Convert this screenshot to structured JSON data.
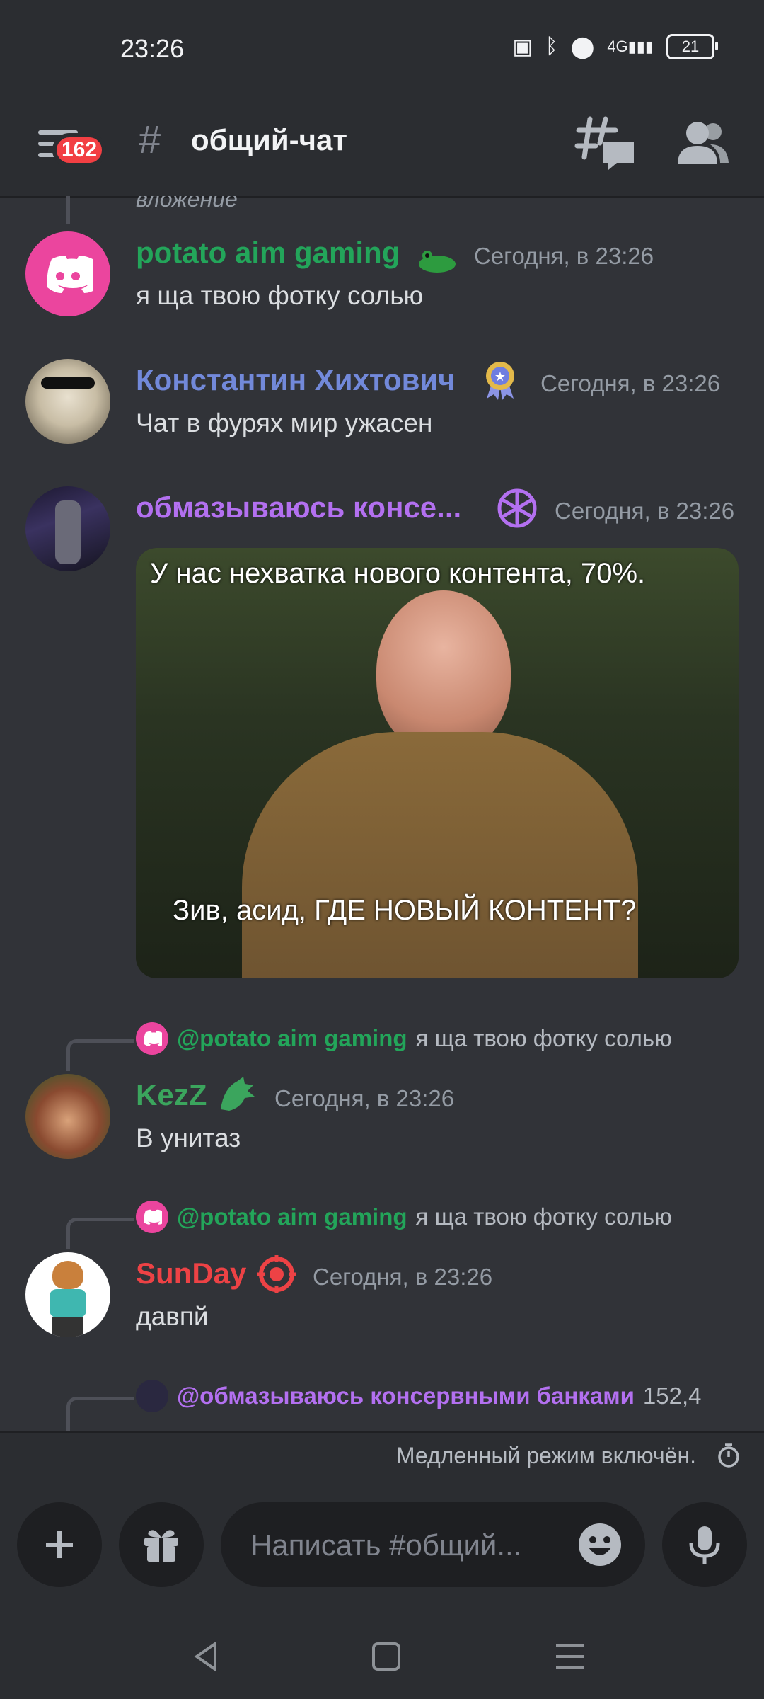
{
  "status_bar": {
    "time": "23:26",
    "battery": "21",
    "network": "4G"
  },
  "header": {
    "unread_badge": "162",
    "channel_name": "общий-чат"
  },
  "messages": [
    {
      "username": "potato aim gaming",
      "username_color": "#23a55a",
      "timestamp": "Сегодня, в 23:26",
      "content": "я ща твою фотку солью",
      "avatar_color": "#eb459e"
    },
    {
      "username": "Константин Хихтович",
      "username_color": "#7289da",
      "timestamp": "Сегодня, в 23:26",
      "content": "Чат в фурях мир ужасен"
    },
    {
      "username": "обмазываюсь консе...",
      "username_color": "#b370f0",
      "timestamp": "Сегодня, в 23:26",
      "image": {
        "caption_top": "У нас нехватка нового контента, 70%.",
        "caption_bottom": "Зив, асид, ГДЕ НОВЫЙ КОНТЕНТ?"
      }
    },
    {
      "reply": {
        "mention": "@potato aim gaming",
        "text": "я ща твою фотку солью"
      },
      "username": "KezZ",
      "username_color": "#3ba55d",
      "timestamp": "Сегодня, в 23:26",
      "content": "В унитаз"
    },
    {
      "reply": {
        "mention": "@potato aim gaming",
        "text": "я ща твою фотку солью"
      },
      "username": "SunDay",
      "username_color": "#ed4245",
      "timestamp": "Сегодня, в 23:26",
      "content": "давпй"
    },
    {
      "reply": {
        "mention": "@обмазываюсь консервными банками",
        "text": "152,4"
      }
    }
  ],
  "fade_text": "вложение",
  "slow_mode": "Медленный режим включён.",
  "composer": {
    "placeholder": "Написать #общий..."
  }
}
